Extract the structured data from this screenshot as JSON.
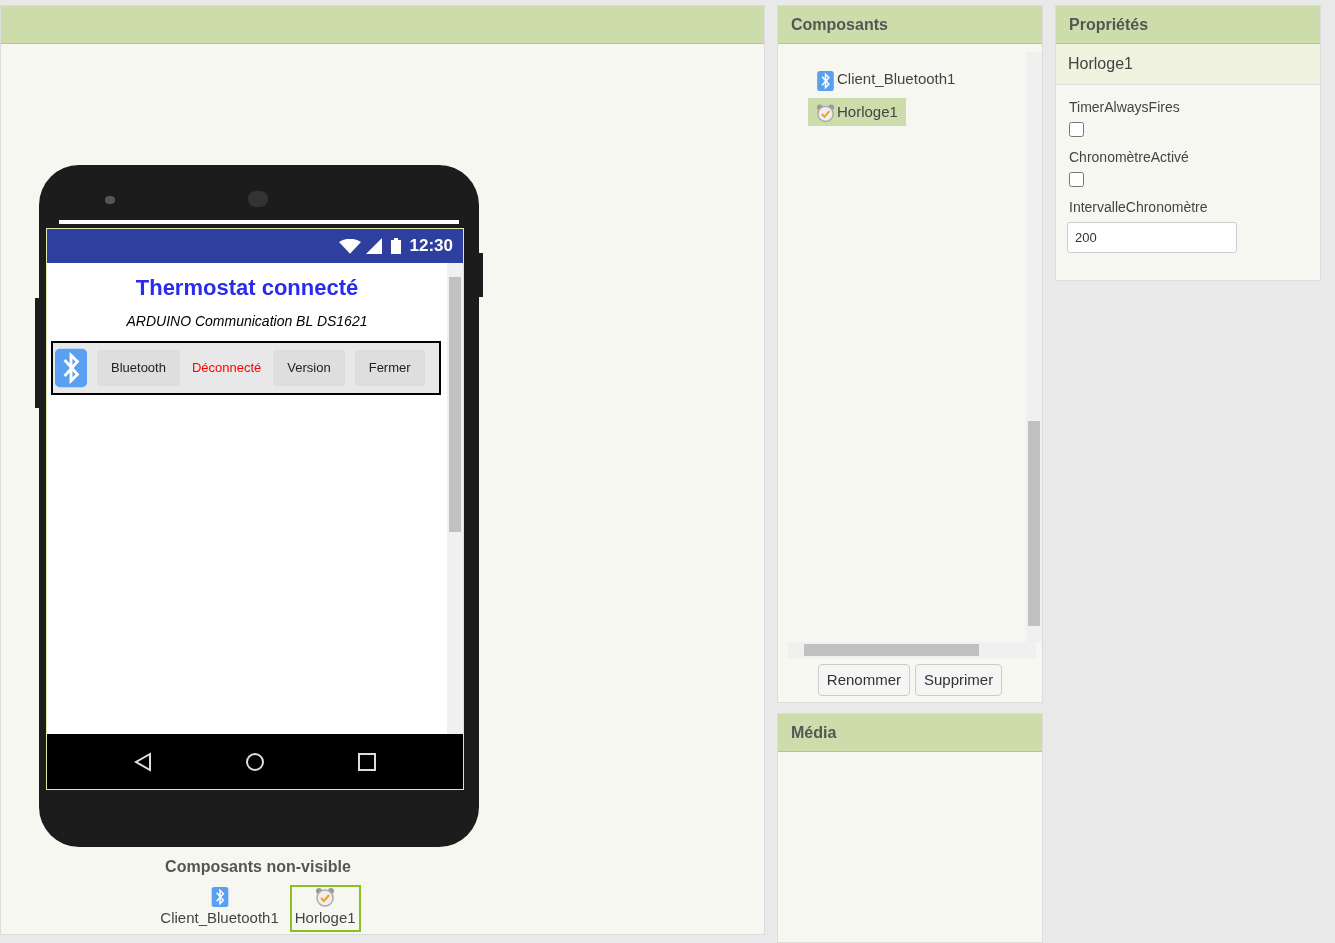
{
  "designer": {
    "phone": {
      "status_time": "12:30",
      "title": "Thermostat connecté",
      "subtitle": "ARDUINO Communication BL DS1621",
      "controls": [
        {
          "kind": "button",
          "label": "Bluetooth"
        },
        {
          "kind": "label",
          "label": "Déconnecté"
        },
        {
          "kind": "button",
          "label": "Version"
        },
        {
          "kind": "button",
          "label": "Fermer"
        }
      ]
    },
    "nonvisible": {
      "title": "Composants non-visible",
      "items": [
        {
          "kind": "bluetooth",
          "label": "Client_Bluetooth1",
          "selected": false
        },
        {
          "kind": "clock",
          "label": "Horloge1",
          "selected": true
        }
      ]
    }
  },
  "components": {
    "title": "Composants",
    "items": [
      {
        "kind": "bluetooth",
        "label": "Client_Bluetooth1",
        "selected": false
      },
      {
        "kind": "clock",
        "label": "Horloge1",
        "selected": true
      }
    ],
    "buttons": [
      "Renommer",
      "Supprimer"
    ]
  },
  "media": {
    "title": "Média"
  },
  "properties": {
    "title": "Propriétés",
    "component": "Horloge1",
    "props": [
      {
        "kind": "checkbox",
        "label": "TimerAlwaysFires",
        "checked": false
      },
      {
        "kind": "checkbox",
        "label": "ChronomètreActivé",
        "checked": false
      },
      {
        "kind": "text",
        "label": "IntervalleChronomètre",
        "value": "200"
      }
    ]
  }
}
